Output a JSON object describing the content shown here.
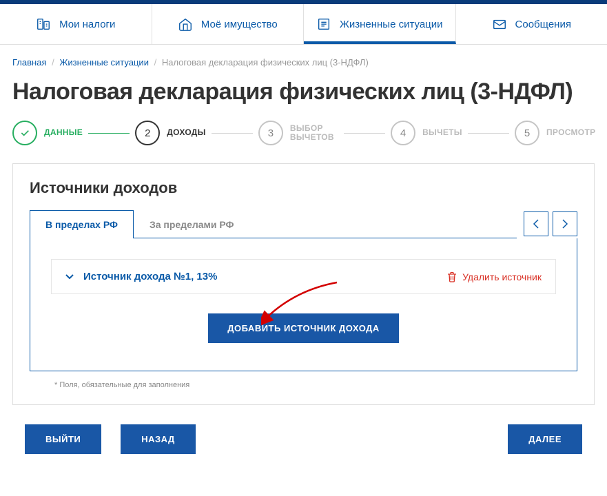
{
  "nav": {
    "items": [
      {
        "label": "Мои налоги",
        "icon": "taxes-icon"
      },
      {
        "label": "Моё имущество",
        "icon": "property-icon"
      },
      {
        "label": "Жизненные ситуации",
        "icon": "situations-icon",
        "active": true
      },
      {
        "label": "Сообщения",
        "icon": "messages-icon"
      }
    ]
  },
  "breadcrumb": {
    "home": "Главная",
    "section": "Жизненные ситуации",
    "current": "Налоговая декларация физических лиц (3-НДФЛ)"
  },
  "page_title": "Налоговая декларация физических лиц (3-НДФЛ)",
  "stepper": {
    "steps": [
      {
        "num": "✓",
        "label": "ДАННЫЕ",
        "state": "done"
      },
      {
        "num": "2",
        "label": "ДОХОДЫ",
        "state": "current"
      },
      {
        "num": "3",
        "label": "ВЫБОР ВЫЧЕТОВ",
        "state": "pending"
      },
      {
        "num": "4",
        "label": "ВЫЧЕТЫ",
        "state": "pending"
      },
      {
        "num": "5",
        "label": "ПРОСМОТР",
        "state": "pending"
      }
    ]
  },
  "panel": {
    "title": "Источники доходов",
    "tabs": [
      {
        "label": "В пределах РФ",
        "active": true
      },
      {
        "label": "За пределами РФ",
        "active": false
      }
    ],
    "source": {
      "title": "Источник дохода №1, 13%",
      "delete_label": "Удалить источник"
    },
    "add_button": "ДОБАВИТЬ ИСТОЧНИК ДОХОДА"
  },
  "footnote": "* Поля, обязательные для заполнения",
  "buttons": {
    "exit": "ВЫЙТИ",
    "back": "НАЗАД",
    "next": "ДАЛЕЕ"
  },
  "colors": {
    "primary": "#1957a6",
    "link": "#0a5aa8",
    "success": "#27ae60",
    "danger": "#d93025"
  }
}
